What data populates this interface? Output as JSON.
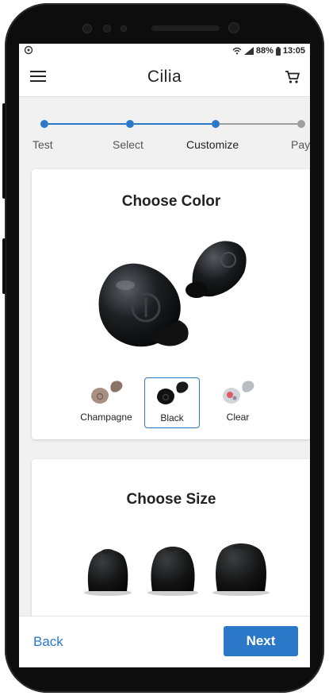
{
  "status_bar": {
    "battery": "88%",
    "time": "13:05"
  },
  "app_bar": {
    "title": "Cilia"
  },
  "stepper": {
    "steps": [
      {
        "label": "Test",
        "state": "complete"
      },
      {
        "label": "Select",
        "state": "complete"
      },
      {
        "label": "Customize",
        "state": "current"
      },
      {
        "label": "Pay",
        "state": "upcoming"
      }
    ]
  },
  "color_card": {
    "title": "Choose Color",
    "options": [
      {
        "label": "Champagne",
        "selected": false
      },
      {
        "label": "Black",
        "selected": true
      },
      {
        "label": "Clear",
        "selected": false
      }
    ]
  },
  "size_card": {
    "title": "Choose Size"
  },
  "footer": {
    "back_label": "Back",
    "next_label": "Next"
  },
  "colors": {
    "accent": "#2a78c7",
    "inactive": "#9e9e9e"
  },
  "icons": [
    "menu-icon",
    "cart-icon",
    "wifi-icon",
    "signal-icon",
    "battery-icon"
  ]
}
